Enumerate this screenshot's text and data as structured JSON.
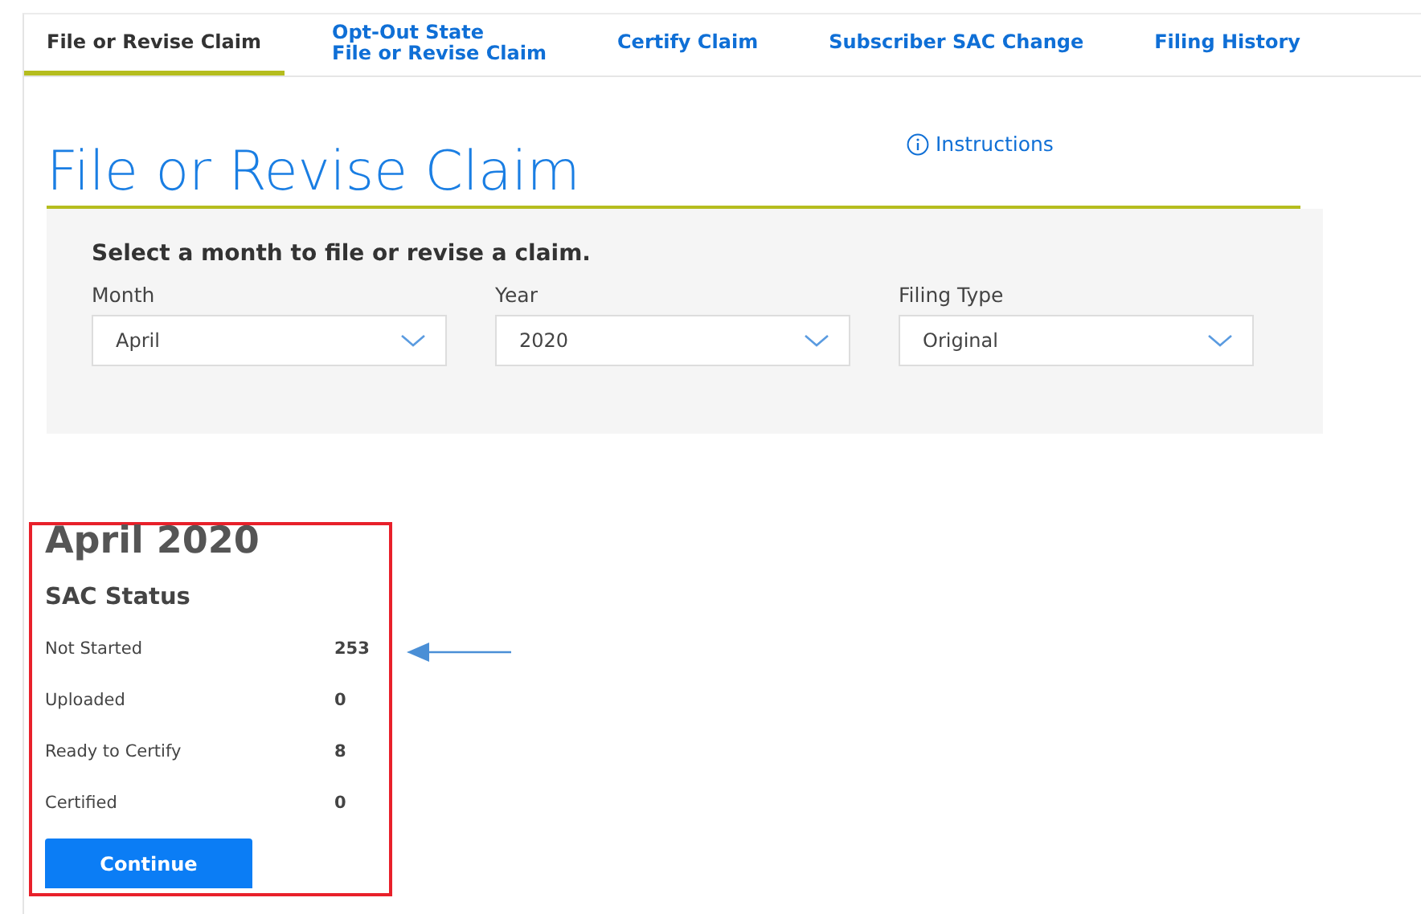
{
  "tabs": [
    {
      "label": "File or Revise Claim",
      "selected": true
    },
    {
      "label": "Opt-Out State\nFile or Revise Claim",
      "selected": false
    },
    {
      "label": "Certify Claim",
      "selected": false
    },
    {
      "label": "Subscriber SAC Change",
      "selected": false
    },
    {
      "label": "Filing History",
      "selected": false
    }
  ],
  "page_title": "File or Revise Claim",
  "instructions_link": "Instructions",
  "filter_panel": {
    "heading": "Select a month to file or revise a claim.",
    "fields": [
      {
        "label": "Month",
        "value": "April"
      },
      {
        "label": "Year",
        "value": "2020"
      },
      {
        "label": "Filing Type",
        "value": "Original"
      }
    ]
  },
  "summary": {
    "title": "April 2020",
    "subtitle": "SAC Status",
    "rows": [
      {
        "label": "Not Started",
        "count": "253"
      },
      {
        "label": "Uploaded",
        "count": "0"
      },
      {
        "label": "Ready to Certify",
        "count": "8"
      },
      {
        "label": "Certified",
        "count": "0"
      }
    ],
    "button": "Continue"
  }
}
